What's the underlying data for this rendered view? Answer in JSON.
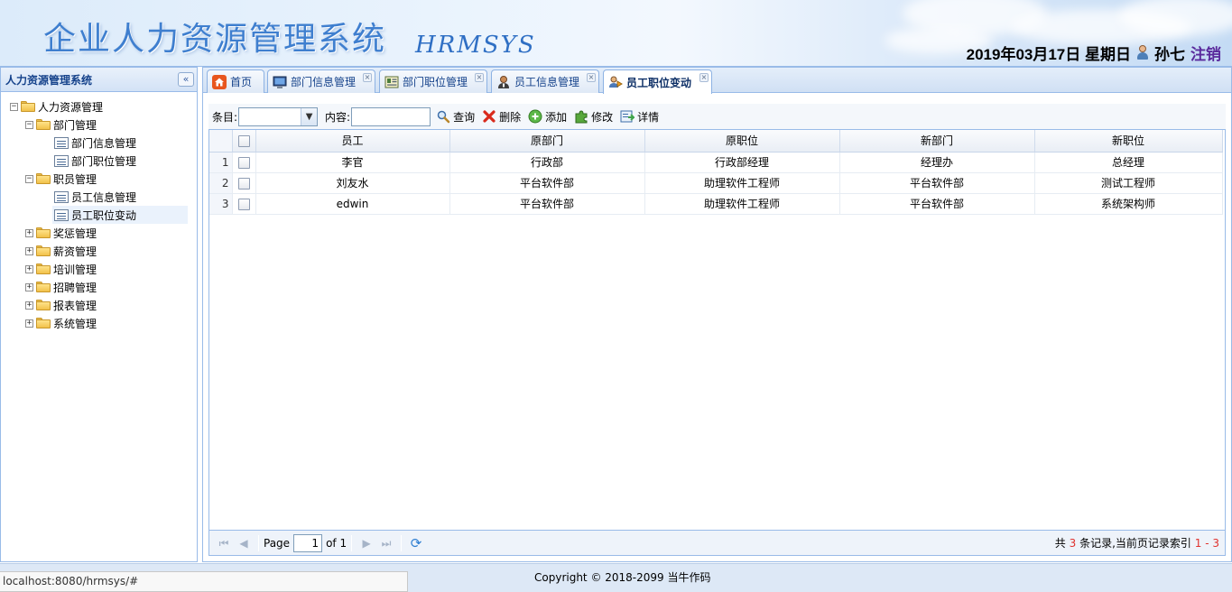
{
  "header": {
    "title": "企业人力资源管理系统",
    "subtitle": "HRMSYS",
    "date": "2019年03月17日 星期日",
    "username": "孙七",
    "logout_label": "注销"
  },
  "sidebar": {
    "title": "人力资源管理系统",
    "collapse_icon": "double-chevron-left-icon",
    "tree": {
      "root": "人力资源管理",
      "dept_group": "部门管理",
      "dept_info": "部门信息管理",
      "dept_position": "部门职位管理",
      "staff_group": "职员管理",
      "staff_info": "员工信息管理",
      "staff_change": "员工职位变动",
      "reward": "奖惩管理",
      "salary": "薪资管理",
      "training": "培训管理",
      "recruit": "招聘管理",
      "report": "报表管理",
      "system": "系统管理"
    }
  },
  "tabs": [
    {
      "label": "首页",
      "icon": "home-icon"
    },
    {
      "label": "部门信息管理",
      "icon": "monitor-icon"
    },
    {
      "label": "部门职位管理",
      "icon": "id-card-icon"
    },
    {
      "label": "员工信息管理",
      "icon": "user-icon"
    },
    {
      "label": "员工职位变动",
      "icon": "user-change-icon"
    }
  ],
  "toolbar": {
    "field_label": "条目:",
    "content_label": "内容:",
    "search_label": "查询",
    "delete_label": "删除",
    "add_label": "添加",
    "edit_label": "修改",
    "detail_label": "详情"
  },
  "grid": {
    "columns": [
      "员工",
      "原部门",
      "原职位",
      "新部门",
      "新职位"
    ],
    "rows": [
      {
        "num": "1",
        "cells": [
          "李官",
          "行政部",
          "行政部经理",
          "经理办",
          "总经理"
        ]
      },
      {
        "num": "2",
        "cells": [
          "刘友水",
          "平台软件部",
          "助理软件工程师",
          "平台软件部",
          "测试工程师"
        ]
      },
      {
        "num": "3",
        "cells": [
          "edwin",
          "平台软件部",
          "助理软件工程师",
          "平台软件部",
          "系统架构师"
        ]
      }
    ]
  },
  "pager": {
    "page_label": "Page",
    "page_value": "1",
    "of_label": "of 1",
    "info_prefix": "共",
    "total": "3",
    "info_middle": "条记录,当前页记录索引",
    "range": "1 - 3"
  },
  "footer": {
    "copyright": "Copyright © 2018-2099 当牛作码",
    "status_url": "localhost:8080/hrmsys/#"
  },
  "colors": {
    "panel_border": "#99bbe8",
    "title_blue": "#15428b",
    "logout_purple": "#5a2a9c",
    "pager_red": "#e0322e"
  }
}
